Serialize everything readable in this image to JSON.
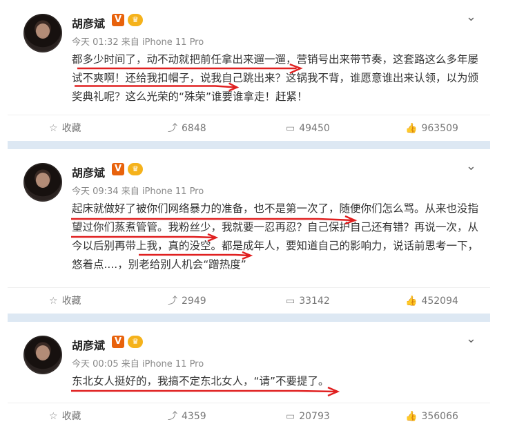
{
  "posts": [
    {
      "name": "胡彦斌",
      "vip_badge": "V",
      "crown_badge": "♛",
      "time": "今天 01:32",
      "source": "来自 iPhone 11 Pro",
      "text": "都多少时间了，动不动就把前任拿出来遛一遛，营销号出来带节奏，这套路这么多年屡试不爽啊！还给我扣帽子，说我自己跳出来？这锅我不背，谁愿意谁出来认领，以为颁奖典礼呢？这么光荣的“殊荣”谁要谁拿走！赶紧！",
      "actions": {
        "favorite": "收藏",
        "repost": "6848",
        "comment": "49450",
        "like": "963509"
      }
    },
    {
      "name": "胡彦斌",
      "vip_badge": "V",
      "crown_badge": "♛",
      "time": "今天 09:34",
      "source": "来自 iPhone 11 Pro",
      "text": "起床就做好了被你们网络暴力的准备，也不是第一次了，随便你们怎么骂。从来也没指望过你们蒸煮管管。我粉丝少，我就要一忍再忍？自己保护自己还有错？再说一次，从今以后别再带上我，真的没空。都是成年人，要知道自己的影响力，说话前思考一下，悠着点....，别老给别人机会“蹭热度”",
      "actions": {
        "favorite": "收藏",
        "repost": "2949",
        "comment": "33142",
        "like": "452094"
      }
    },
    {
      "name": "胡彦斌",
      "vip_badge": "V",
      "crown_badge": "♛",
      "time": "今天 00:05",
      "source": "来自 iPhone 11 Pro",
      "text": "东北女人挺好的，我搞不定东北女人，“请”不要提了。",
      "actions": {
        "favorite": "收藏",
        "repost": "4359",
        "comment": "20793",
        "like": "356066"
      }
    }
  ],
  "icons": {
    "favorite": "star-icon",
    "repost": "repost-icon",
    "comment": "comment-icon",
    "like": "thumb-up-icon",
    "more": "chevron-down-icon"
  },
  "colors": {
    "underline": "#e02020",
    "separator": "#dde8f3",
    "vip_badge": "#e8620c",
    "crown_badge": "#f5b21b"
  }
}
